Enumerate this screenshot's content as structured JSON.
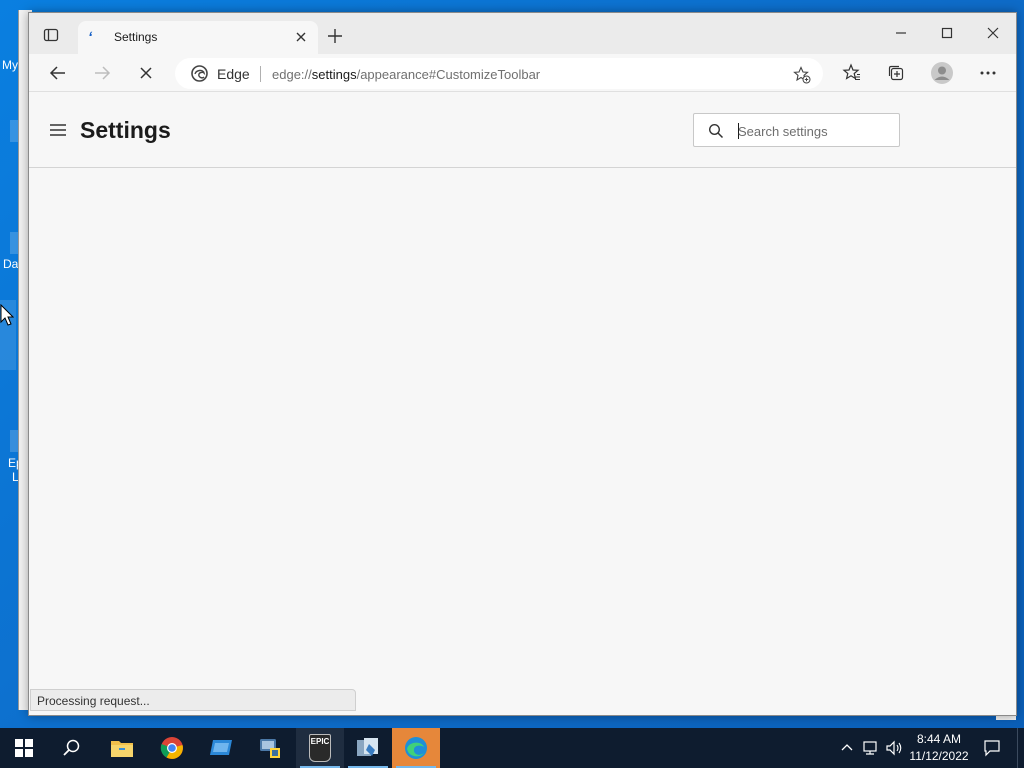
{
  "desktop": {
    "icon_labels": [
      "My",
      "Da",
      "Ep",
      "L"
    ]
  },
  "browser": {
    "tab": {
      "title": "Settings"
    },
    "address_bar": {
      "site_label": "Edge",
      "url_scheme": "edge://",
      "url_host": "settings",
      "url_path": "/appearance#CustomizeToolbar"
    },
    "status_text": "Processing request..."
  },
  "settings_page": {
    "title": "Settings",
    "search": {
      "placeholder": "Search settings",
      "value": ""
    }
  },
  "taskbar": {
    "apps": [
      "start",
      "search",
      "file-explorer",
      "chrome",
      "remote-desktop",
      "python",
      "epic-games",
      "tool-app",
      "edge"
    ],
    "epic_label": "EPIC",
    "clock": {
      "time": "8:44 AM",
      "date": "11/12/2022"
    }
  },
  "colors": {
    "accent": "#0078d4",
    "taskbar": "#0e1c2f",
    "desktop": "#0a78d7"
  }
}
